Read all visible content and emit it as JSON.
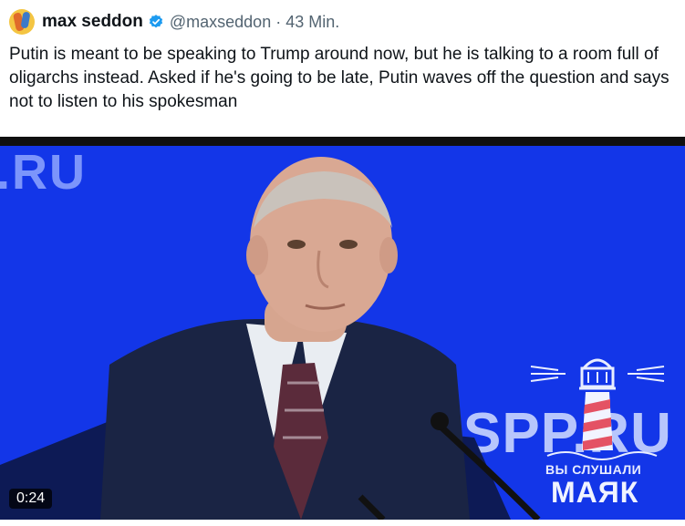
{
  "tweet": {
    "author_name": "max seddon",
    "handle": "@maxseddon",
    "separator": "·",
    "time": "43 Min.",
    "text": "Putin is meant to be speaking to Trump around now, but he is talking to a room full of oligarchs instead. Asked if he's going to be late, Putin waves off the question and says not to listen to his spokesman",
    "verified_color": "#1d9bf0"
  },
  "video": {
    "duration": "0:24",
    "background_text_top": ".RU",
    "background_text_right": "SPP.RU",
    "watermark_line1": "ВЫ СЛУШАЛИ",
    "watermark_line2": "МАЯК"
  },
  "icons": {
    "avatar": "avatar-icon",
    "verified": "verified-badge-icon",
    "watermark": "lighthouse-icon"
  }
}
